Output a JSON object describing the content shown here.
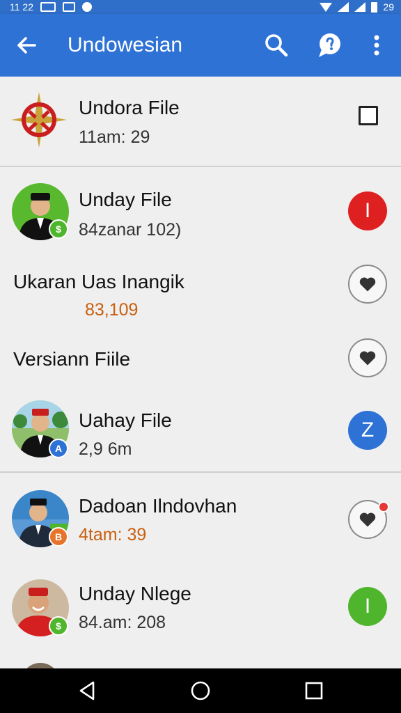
{
  "status_bar": {
    "time": "11 22",
    "battery": "29"
  },
  "app_bar": {
    "title": "Undowesian",
    "icons": [
      "back-arrow-icon",
      "search-icon",
      "chat-bubble-icon",
      "more-vert-icon"
    ]
  },
  "items": [
    {
      "name": "Undora File",
      "sub": "11am: 29",
      "action": "checkbox",
      "avatar": "emblem"
    },
    {
      "name": "Unday File",
      "sub": "84zanar 102)",
      "action": "red-circle",
      "action_label": "I",
      "avatar": "person-green",
      "badge": "$"
    },
    {
      "name": "Ukaran Uas Inangik",
      "sub": "83,109",
      "action": "heart",
      "sub_color": "orange"
    },
    {
      "name": "Versiann Fiile",
      "action": "heart"
    },
    {
      "name": "Uahay File",
      "sub": "2,9 6m",
      "action": "blue-circle",
      "action_label": "Z",
      "avatar": "person-outdoor",
      "badge": "A"
    },
    {
      "name": "Dadoan Ilndovhan",
      "sub": "4tam: 39",
      "action": "heart-dot",
      "sub_color": "orange",
      "avatar": "person-blue",
      "badge": "B"
    },
    {
      "name": "Unday Nlege",
      "sub": "84.am: 208",
      "action": "green-circle",
      "action_label": "I",
      "avatar": "person-red",
      "badge": "$"
    }
  ],
  "colors": {
    "app_bar": "#2f72d6",
    "red": "#de2020",
    "blue": "#2f72d6",
    "green": "#4fb52c",
    "orange_text": "#c8600f"
  }
}
